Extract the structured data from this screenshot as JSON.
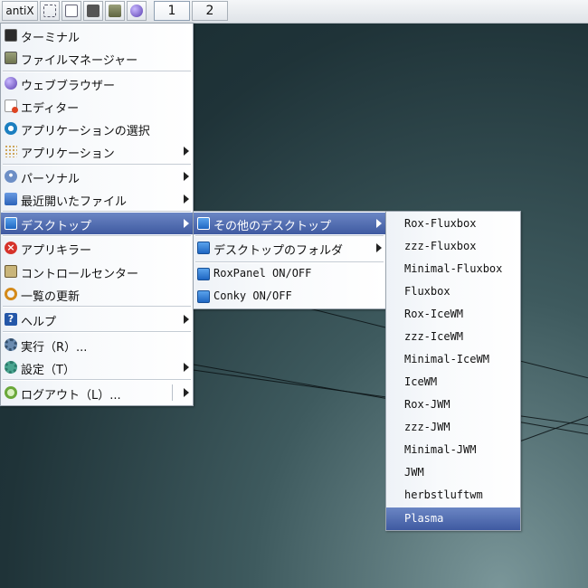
{
  "taskbar": {
    "start_label": "antiX",
    "launchers": [
      {
        "icon": "fullscreen-icon"
      },
      {
        "icon": "file-manager-icon"
      },
      {
        "icon": "terminal-icon"
      },
      {
        "icon": "editor-icon"
      },
      {
        "icon": "web-browser-icon"
      }
    ],
    "workspaces": [
      {
        "label": "1",
        "active": true
      },
      {
        "label": "2",
        "active": false
      }
    ]
  },
  "main_menu": {
    "items": [
      {
        "label": "ターミナル",
        "icon": "terminal-icon"
      },
      {
        "label": "ファイルマネージャー",
        "icon": "file-manager-icon"
      },
      {
        "label": "ウェブブラウザー",
        "icon": "web-browser-icon"
      },
      {
        "label": "エディター",
        "icon": "editor-icon"
      },
      {
        "label": "アプリケーションの選択",
        "icon": "search-icon"
      },
      {
        "label": "アプリケーション",
        "icon": "apps-grid-icon",
        "submenu": true
      },
      {
        "label": "パーソナル",
        "icon": "person-icon",
        "submenu": true
      },
      {
        "label": "最近開いたファイル",
        "icon": "recent-files-icon",
        "submenu": true
      },
      {
        "label": "デスクトップ",
        "icon": "desktop-icon",
        "submenu": true,
        "selected": true
      },
      {
        "label": "アプリキラー",
        "icon": "app-killer-icon"
      },
      {
        "label": "コントロールセンター",
        "icon": "control-center-icon"
      },
      {
        "label": "一覧の更新",
        "icon": "refresh-icon"
      },
      {
        "label": "ヘルプ",
        "icon": "help-icon",
        "submenu": true
      },
      {
        "label": "実行（R）...",
        "icon": "run-icon"
      },
      {
        "label": "設定（T）",
        "icon": "settings-icon",
        "submenu": true
      },
      {
        "label": "ログアウト（L）...",
        "icon": "logout-icon",
        "submenu": true
      }
    ]
  },
  "desktop_menu": {
    "items": [
      {
        "label": "その他のデスクトップ",
        "icon": "desktop-icon",
        "submenu": true,
        "selected": true
      },
      {
        "label": "デスクトップのフォルダ",
        "icon": "desktop-icon",
        "submenu": true
      },
      {
        "label": "RoxPanel ON/OFF",
        "icon": "desktop-icon"
      },
      {
        "label": "Conky ON/OFF",
        "icon": "desktop-icon"
      }
    ]
  },
  "other_desktops_menu": {
    "items": [
      "Rox-Fluxbox",
      "zzz-Fluxbox",
      "Minimal-Fluxbox",
      "Fluxbox",
      "Rox-IceWM",
      "zzz-IceWM",
      "Minimal-IceWM",
      "IceWM",
      "Rox-JWM",
      "zzz-JWM",
      "Minimal-JWM",
      "JWM",
      "herbstluftwm",
      "Plasma"
    ],
    "selected": "Plasma"
  }
}
